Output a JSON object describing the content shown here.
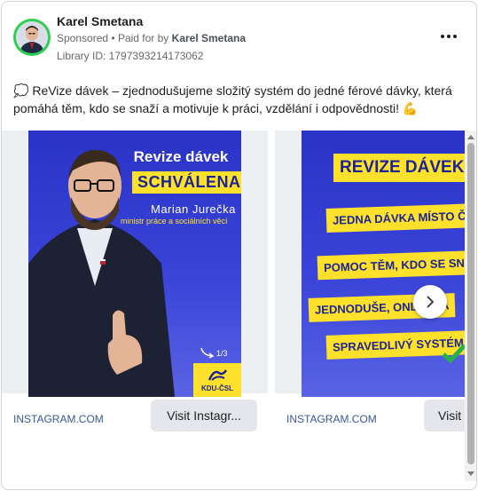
{
  "advertiser": {
    "name": "Karel Smetana",
    "sponsored_label": "Sponsored",
    "separator": "•",
    "paid_for_by_label": "Paid for by",
    "paid_for_by_name": "Karel Smetana",
    "library_id": "Library ID: 1797393214173062"
  },
  "post": {
    "emoji_prefix": "💭",
    "text": "ReVize dávek – zjednodušujeme složitý systém do jedné férové dávky, která pomáhá těm, kdo se snaží a motivuje k práci, vzdělání i odpovědnosti!",
    "emoji_suffix": "💪"
  },
  "carousel": {
    "slides": [
      {
        "domain": "INSTAGRAM.COM",
        "cta": "Visit Instagr...",
        "title": "Revize dávek",
        "highlight": "SCHVÁLENA",
        "person_name": "Marian Jurečka",
        "person_role": "ministr práce a sociálních věcí",
        "page_indicator": "1/3",
        "logo_text": "KDU-ČSL"
      },
      {
        "domain": "INSTAGRAM.COM",
        "cta": "Visit",
        "title": "REVIZE DÁVEK",
        "lines": [
          "JEDNA DÁVKA MÍSTO ČT",
          "POMOC TĚM, KDO SE SNAŽ",
          "JEDNODUŠE, ONLI   Z PA",
          "SPRAVEDLIVÝ SYSTÉM"
        ]
      }
    ]
  },
  "colors": {
    "avatar_ring": "#2ad14d",
    "link_domain": "#385898",
    "ad_blue": "#2b33c7",
    "ad_yellow": "#ffe12b",
    "cta_bg": "#e4e6eb"
  },
  "icons": {
    "more": "three-dots-icon",
    "next": "chevron-right-icon"
  }
}
